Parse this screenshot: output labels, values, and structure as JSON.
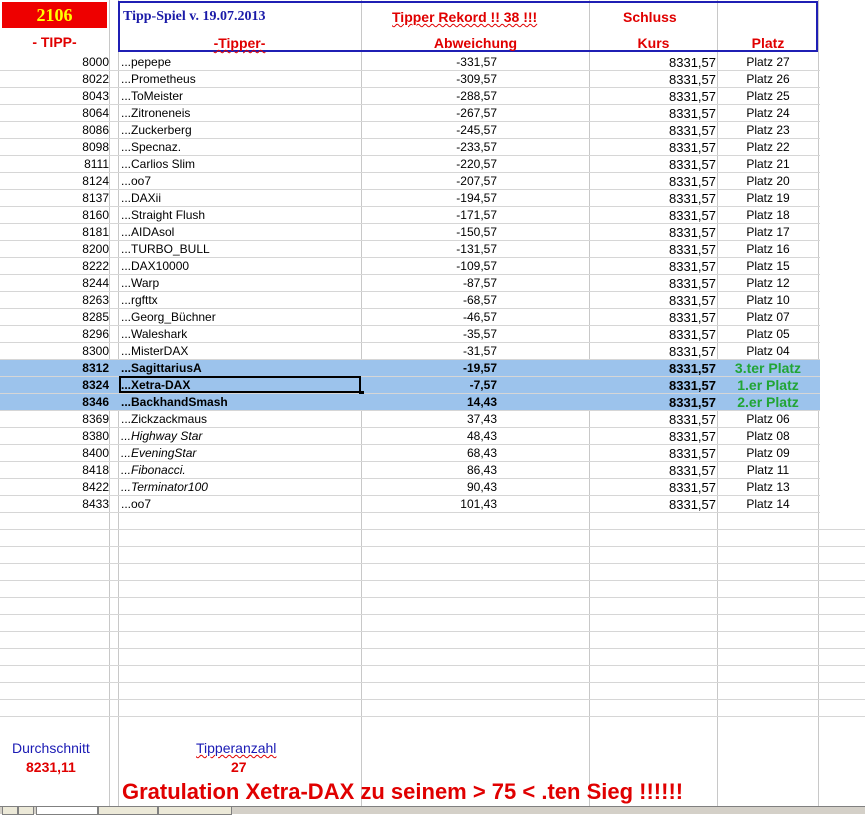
{
  "header": {
    "tipp_number": "2106",
    "game_title": "Tipp-Spiel v. 19.07.2013",
    "rekord_label": "Tipper Rekord !!  38  !!!",
    "schluss_label": "Schluss",
    "col_tipp": "- TIPP-",
    "col_tipper": "-Tipper-",
    "col_abweichung": "Abweichung",
    "col_kurs": "Kurs",
    "col_platz": "Platz"
  },
  "rows": [
    {
      "tipp": "8000",
      "name": "...pepepe",
      "abw": "-331,57",
      "kurs": "8331,57",
      "platz": "Platz 27"
    },
    {
      "tipp": "8022",
      "name": "...Prometheus",
      "abw": "-309,57",
      "kurs": "8331,57",
      "platz": "Platz 26"
    },
    {
      "tipp": "8043",
      "name": "...ToMeister",
      "abw": "-288,57",
      "kurs": "8331,57",
      "platz": "Platz 25"
    },
    {
      "tipp": "8064",
      "name": "...Zitroneneis",
      "abw": "-267,57",
      "kurs": "8331,57",
      "platz": "Platz 24"
    },
    {
      "tipp": "8086",
      "name": "...Zuckerberg",
      "abw": "-245,57",
      "kurs": "8331,57",
      "platz": "Platz 23"
    },
    {
      "tipp": "8098",
      "name": "...Specnaz.",
      "abw": "-233,57",
      "kurs": "8331,57",
      "platz": "Platz 22"
    },
    {
      "tipp": "8111",
      "name": "...Carlios Slim",
      "abw": "-220,57",
      "kurs": "8331,57",
      "platz": "Platz 21"
    },
    {
      "tipp": "8124",
      "name": "...oo7",
      "abw": "-207,57",
      "kurs": "8331,57",
      "platz": "Platz 20"
    },
    {
      "tipp": "8137",
      "name": "...DAXii",
      "abw": "-194,57",
      "kurs": "8331,57",
      "platz": "Platz 19"
    },
    {
      "tipp": "8160",
      "name": "...Straight Flush",
      "abw": "-171,57",
      "kurs": "8331,57",
      "platz": "Platz 18"
    },
    {
      "tipp": "8181",
      "name": "...AIDAsol",
      "abw": "-150,57",
      "kurs": "8331,57",
      "platz": "Platz 17"
    },
    {
      "tipp": "8200",
      "name": "...TURBO_BULL",
      "abw": "-131,57",
      "kurs": "8331,57",
      "platz": "Platz 16"
    },
    {
      "tipp": "8222",
      "name": "...DAX10000",
      "abw": "-109,57",
      "kurs": "8331,57",
      "platz": "Platz 15"
    },
    {
      "tipp": "8244",
      "name": "...Warp",
      "abw": "-87,57",
      "kurs": "8331,57",
      "platz": "Platz 12"
    },
    {
      "tipp": "8263",
      "name": "...rgfttx",
      "abw": "-68,57",
      "kurs": "8331,57",
      "platz": "Platz 10"
    },
    {
      "tipp": "8285",
      "name": "...Georg_Büchner",
      "abw": "-46,57",
      "kurs": "8331,57",
      "platz": "Platz 07"
    },
    {
      "tipp": "8296",
      "name": "...Waleshark",
      "abw": "-35,57",
      "kurs": "8331,57",
      "platz": "Platz 05"
    },
    {
      "tipp": "8300",
      "name": "...MisterDAX",
      "abw": "-31,57",
      "kurs": "8331,57",
      "platz": "Platz 04"
    },
    {
      "tipp": "8312",
      "name": "...SagittariusA",
      "abw": "-19,57",
      "kurs": "8331,57",
      "platz": "3.ter Platz",
      "highlight": true
    },
    {
      "tipp": "8324",
      "name": "...Xetra-DAX",
      "abw": "-7,57",
      "kurs": "8331,57",
      "platz": "1.er Platz",
      "highlight": true,
      "selected": true
    },
    {
      "tipp": "8346",
      "name": "...BackhandSmash",
      "abw": "14,43",
      "kurs": "8331,57",
      "platz": "2.er Platz",
      "highlight": true
    },
    {
      "tipp": "8369",
      "name": "...Zickzackmaus",
      "abw": "37,43",
      "kurs": "8331,57",
      "platz": "Platz 06"
    },
    {
      "tipp": "8380",
      "name": "...Highway Star",
      "abw": "48,43",
      "kurs": "8331,57",
      "platz": "Platz 08",
      "italic": true
    },
    {
      "tipp": "8400",
      "name": "...EveningStar",
      "abw": "68,43",
      "kurs": "8331,57",
      "platz": "Platz 09",
      "italic": true
    },
    {
      "tipp": "8418",
      "name": "...Fibonacci.",
      "abw": "86,43",
      "kurs": "8331,57",
      "platz": "Platz 11",
      "italic": true
    },
    {
      "tipp": "8422",
      "name": "...Terminator100",
      "abw": "90,43",
      "kurs": "8331,57",
      "platz": "Platz 13",
      "italic": true
    },
    {
      "tipp": "8433",
      "name": "...oo7",
      "abw": "101,43",
      "kurs": "8331,57",
      "platz": "Platz 14"
    }
  ],
  "footer": {
    "durchschnitt_label": "Durchschnitt",
    "durchschnitt_value": "8231,11",
    "tipperanzahl_label": "Tipperanzahl",
    "tipperanzahl_value": "27",
    "gratulation": "Gratulation Xetra-DAX zu seinem > 75 < .ten Sieg !!!!!!"
  },
  "colors": {
    "red": "#e00000",
    "blue": "#1f1fb4",
    "highlight": "#9cc3ec",
    "green": "#21a535",
    "yellow": "#ffff00"
  }
}
